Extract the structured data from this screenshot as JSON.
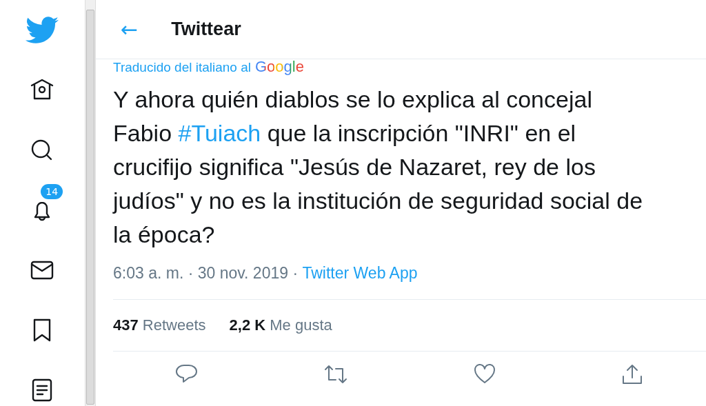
{
  "sidebar": {
    "items": [
      {
        "kind": "logo"
      },
      {
        "kind": "home"
      },
      {
        "kind": "search"
      },
      {
        "kind": "notifications",
        "badge": "14"
      },
      {
        "kind": "messages"
      },
      {
        "kind": "bookmarks"
      },
      {
        "kind": "lists"
      }
    ]
  },
  "header": {
    "back": "←",
    "title": "Twittear"
  },
  "translation": {
    "label": "Traducido del italiano al",
    "provider": "Google"
  },
  "tweet": {
    "parts": [
      {
        "kind": "text",
        "text": "Y ahora quién diablos se lo explica al concejal Fabio "
      },
      {
        "kind": "hashtag",
        "text": "#Tuiach"
      },
      {
        "kind": "text",
        "text": " que la inscripción \"INRI\" en el crucifijo significa \"Jesús de Nazaret, rey de los judíos\" y no es la institución de seguridad social de la época?"
      }
    ],
    "time": "6:03 a. m. · 30 nov. 2019 · ",
    "source": "Twitter Web App"
  },
  "stats": [
    {
      "count": "437",
      "label": "Retweets"
    },
    {
      "count": "2,2 K",
      "label": "Me gusta"
    }
  ],
  "actions": [
    {
      "kind": "reply"
    },
    {
      "kind": "retweet"
    },
    {
      "kind": "like"
    },
    {
      "kind": "share"
    }
  ]
}
